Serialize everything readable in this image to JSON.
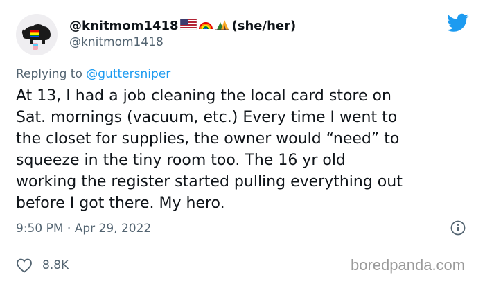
{
  "author": {
    "display_name": "@knitmom1418",
    "pronouns": "(she/her)",
    "handle": "@knitmom1418",
    "emojis": [
      "us-flag-icon",
      "rainbow-icon",
      "camping-tent-icon"
    ]
  },
  "reply": {
    "prefix": "Replying to",
    "handle": "@guttersniper"
  },
  "tweet": {
    "lines": [
      "At 13, I had a job cleaning the local card store on",
      "Sat. mornings (vacuum, etc.) Every time I went to",
      "the closet for supplies, the owner would “need” to",
      "squeeze in the tiny room too. The 16 yr old",
      "working the register started pulling everything out",
      "before I got there. My hero."
    ],
    "timestamp": "9:50 PM · Apr 29, 2022",
    "like_count": "8.8K"
  },
  "watermark": "boredpanda.com",
  "colors": {
    "accent": "#1d9bf0",
    "secondary_text": "#536471",
    "primary_text": "#0f1419"
  }
}
